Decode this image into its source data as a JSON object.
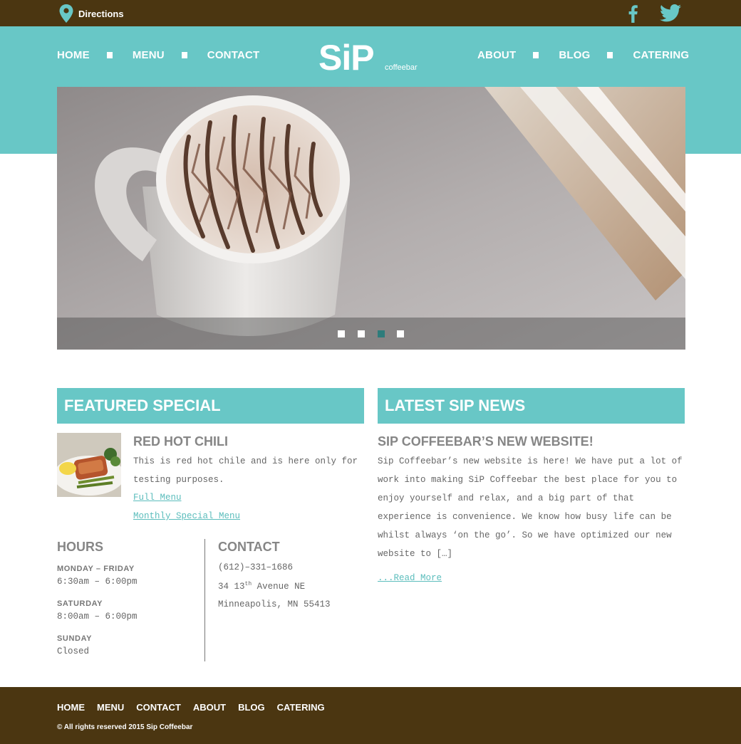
{
  "topbar": {
    "directions_label": "Directions",
    "icons": [
      "map-pin-icon",
      "facebook-icon",
      "twitter-icon"
    ]
  },
  "brand": {
    "logo_main": "SiP",
    "logo_sub": "coffeebar"
  },
  "nav": {
    "left": [
      "HOME",
      "MENU",
      "CONTACT"
    ],
    "right": [
      "ABOUT",
      "BLOG",
      "CATERING"
    ]
  },
  "slider": {
    "slide_count": 4,
    "active_index": 2
  },
  "featured": {
    "heading": "FEATURED SPECIAL",
    "title": "RED HOT CHILI",
    "text": "This is red hot chile and is here only for testing purposes.",
    "links": [
      "Full Menu",
      "Monthly Special Menu"
    ]
  },
  "hours": {
    "heading": "HOURS",
    "rows": [
      {
        "day": "MONDAY – FRIDAY",
        "time": "6:30am – 6:00pm"
      },
      {
        "day": "SATURDAY",
        "time": "8:00am – 6:00pm"
      },
      {
        "day": "SUNDAY",
        "time": "Closed"
      }
    ]
  },
  "contact": {
    "heading": "CONTACT",
    "phone": "(612)–331–1686",
    "street_number": "34 13",
    "street_suffix": "th",
    "street_name": " Avenue NE",
    "city": "Minneapolis, MN 55413"
  },
  "news": {
    "heading": "LATEST SIP NEWS",
    "title": "SIP COFFEEBAR’S NEW WEBSITE!",
    "text": "Sip Coffeebar’s new website is here! We have put a lot of work into making SiP Coffeebar the best place for you to enjoy yourself and relax, and a big part of that experience is convenience. We know how busy life can be whilst always ‘on the go’. So we have optimized our new website to […]",
    "read_more": "...Read More"
  },
  "footer": {
    "nav": [
      "HOME",
      "MENU",
      "CONTACT",
      "ABOUT",
      "BLOG",
      "CATERING"
    ],
    "copyright": "© All rights reserved 2015 Sip Coffeebar"
  },
  "colors": {
    "brown": "#4b3611",
    "teal": "#68c7c6",
    "link": "#5bbdbc",
    "active_dot": "#2e7c7b"
  }
}
